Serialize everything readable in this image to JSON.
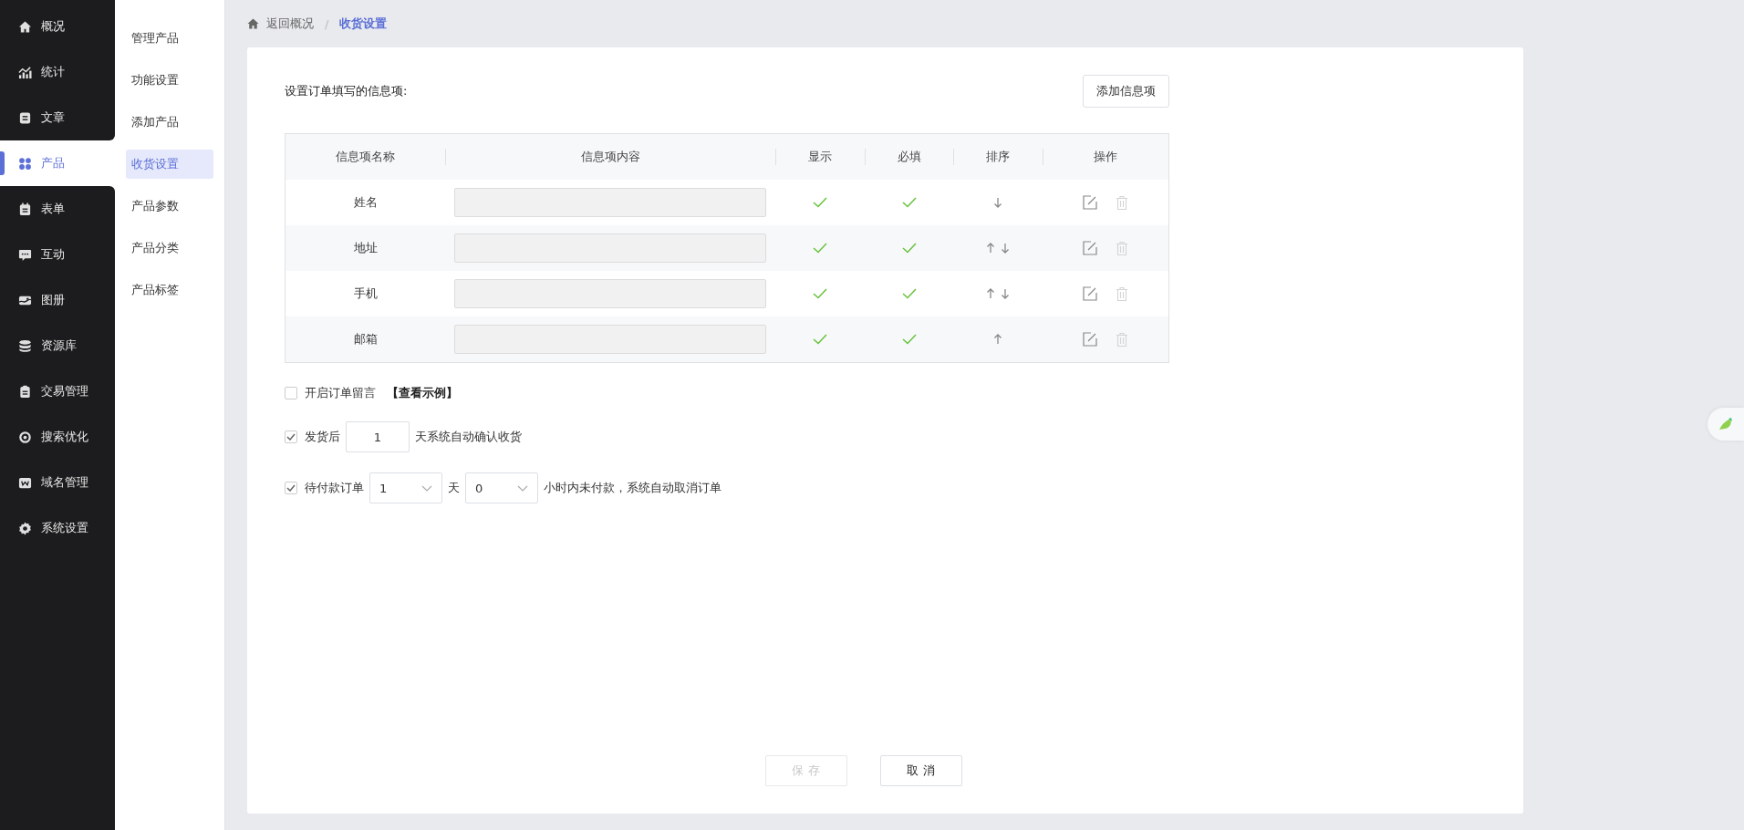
{
  "nav": {
    "items": [
      {
        "label": "概况",
        "selected": false
      },
      {
        "label": "统计",
        "selected": false
      },
      {
        "label": "文章",
        "selected": false
      },
      {
        "label": "产品",
        "selected": true
      },
      {
        "label": "表单",
        "selected": false
      },
      {
        "label": "互动",
        "selected": false
      },
      {
        "label": "图册",
        "selected": false
      },
      {
        "label": "资源库",
        "selected": false
      },
      {
        "label": "交易管理",
        "selected": false
      },
      {
        "label": "搜索优化",
        "selected": false
      },
      {
        "label": "域名管理",
        "selected": false
      },
      {
        "label": "系统设置",
        "selected": false
      }
    ]
  },
  "subnav": {
    "items": [
      {
        "label": "管理产品",
        "selected": false
      },
      {
        "label": "功能设置",
        "selected": false
      },
      {
        "label": "添加产品",
        "selected": false
      },
      {
        "label": "收货设置",
        "selected": true
      },
      {
        "label": "产品参数",
        "selected": false
      },
      {
        "label": "产品分类",
        "selected": false
      },
      {
        "label": "产品标签",
        "selected": false
      }
    ]
  },
  "breadcrumb": {
    "back": "返回概况",
    "separator": "/",
    "current": "收货设置"
  },
  "section_title": "设置订单填写的信息项:",
  "add_button": "添加信息项",
  "table": {
    "columns": [
      "信息项名称",
      "信息项内容",
      "显示",
      "必填",
      "排序",
      "操作"
    ],
    "rows": [
      {
        "name": "姓名",
        "show": true,
        "required": true,
        "can_move_up": false,
        "can_move_down": true,
        "delete_disabled": true
      },
      {
        "name": "地址",
        "show": true,
        "required": true,
        "can_move_up": true,
        "can_move_down": true,
        "delete_disabled": true
      },
      {
        "name": "手机",
        "show": true,
        "required": true,
        "can_move_up": true,
        "can_move_down": true,
        "delete_disabled": true
      },
      {
        "name": "邮箱",
        "show": true,
        "required": true,
        "can_move_up": true,
        "can_move_down": false,
        "delete_disabled": true
      }
    ]
  },
  "order_note": {
    "checked": false,
    "label": "开启订单留言",
    "link": "【查看示例】"
  },
  "auto_confirm": {
    "checked": true,
    "before": "发货后",
    "value": "1",
    "after": "天系统自动确认收货"
  },
  "auto_cancel": {
    "checked": true,
    "label": "待付款订单",
    "days": "1",
    "days_unit": "天",
    "hours": "0",
    "after": "小时内未付款，系统自动取消订单"
  },
  "buttons": {
    "save": {
      "label": "保 存",
      "disabled": true
    },
    "cancel": {
      "label": "取 消"
    }
  }
}
